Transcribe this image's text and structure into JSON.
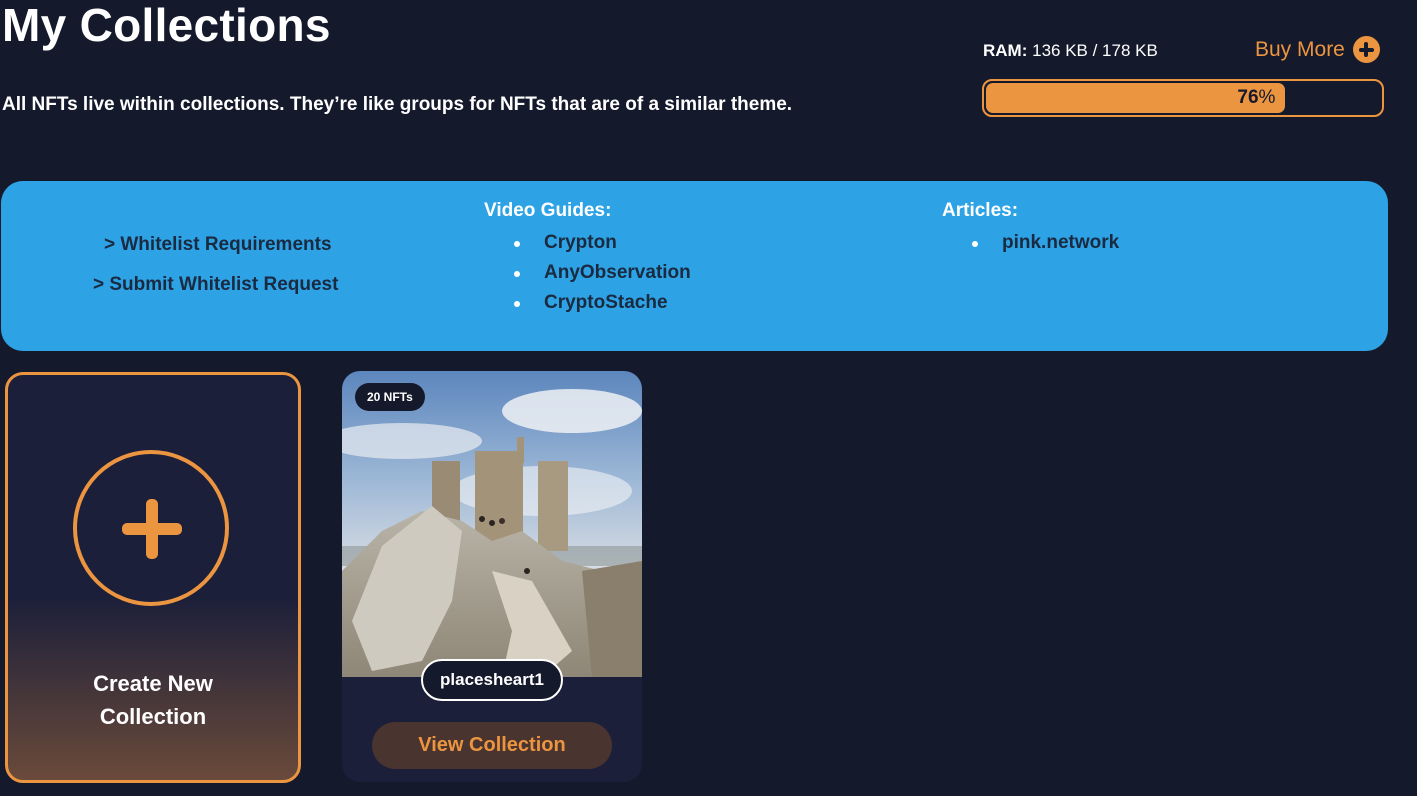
{
  "header": {
    "title": "My Collections",
    "subtitle": "All NFTs live within collections. They’re like groups for NFTs that are of a similar theme."
  },
  "ram": {
    "label": "RAM:",
    "usage": "136 KB / 178 KB",
    "buy_more": "Buy More",
    "percent_value": "76",
    "percent_sign": "%",
    "fill_fraction": 0.76
  },
  "info_panel": {
    "whitelist_requirements": "> Whitelist Requirements",
    "submit_whitelist": "> Submit Whitelist Request",
    "video_guides_title": "Video Guides:",
    "video_guides": [
      "Crypton",
      "AnyObservation",
      "CryptoStache"
    ],
    "articles_title": "Articles:",
    "articles": [
      "pink.network"
    ]
  },
  "create_card": {
    "label": "Create New Collection"
  },
  "collections": [
    {
      "badge": "20 NFTs",
      "name": "placesheart1",
      "button": "View Collection"
    }
  ],
  "colors": {
    "background": "#15192c",
    "accent": "#ec9540",
    "panel": "#2da3e6"
  }
}
